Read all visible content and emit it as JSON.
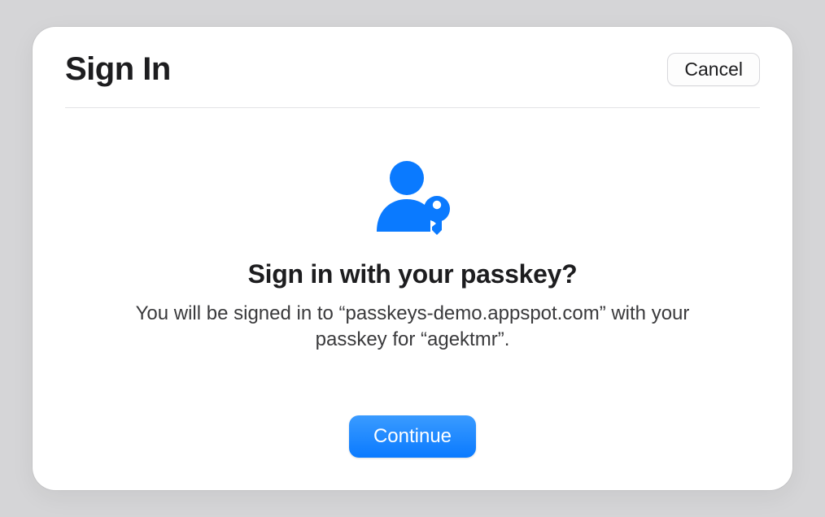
{
  "header": {
    "title": "Sign In",
    "cancel_label": "Cancel"
  },
  "icon": {
    "name": "passkey-user-key-icon",
    "color": "#0a7aff"
  },
  "prompt": {
    "title": "Sign in with your passkey?",
    "body": "You will be signed in to “passkeys-demo.appspot.com” with your passkey for “agektmr”."
  },
  "footer": {
    "continue_label": "Continue"
  }
}
